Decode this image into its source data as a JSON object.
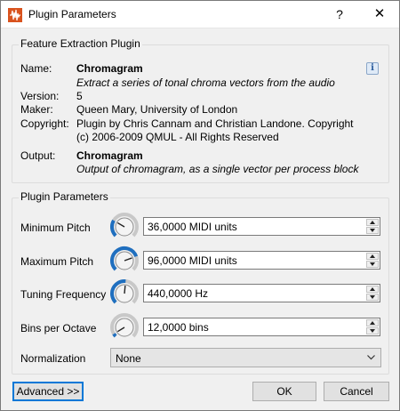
{
  "window": {
    "title": "Plugin Parameters",
    "help": "?",
    "close": "✕"
  },
  "feature_group": {
    "title": "Feature Extraction Plugin",
    "name_label": "Name:",
    "name_value": "Chromagram",
    "name_desc": "Extract a series of tonal chroma vectors from the audio",
    "version_label": "Version:",
    "version_value": "5",
    "maker_label": "Maker:",
    "maker_value": "Queen Mary, University of London",
    "copyright_label": "Copyright:",
    "copyright_line1": "Plugin by Chris Cannam and Christian Landone.  Copyright",
    "copyright_line2": "(c) 2006-2009 QMUL - All Rights Reserved",
    "output_label": "Output:",
    "output_value": "Chromagram",
    "output_desc": "Output of chromagram, as a single vector per process block",
    "info_icon": "i"
  },
  "params_group": {
    "title": "Plugin Parameters",
    "params": [
      {
        "label": "Minimum Pitch",
        "value": "36,0000 MIDI units",
        "level": 0.28
      },
      {
        "label": "Maximum Pitch",
        "value": "96,0000 MIDI units",
        "level": 0.76
      },
      {
        "label": "Tuning Frequency",
        "value": "440,0000 Hz",
        "level": 0.52
      },
      {
        "label": "Bins per Octave",
        "value": "12,0000 bins",
        "level": 0.05
      }
    ],
    "normalization_label": "Normalization",
    "normalization_value": "None"
  },
  "buttons": {
    "advanced": "Advanced >>",
    "ok": "OK",
    "cancel": "Cancel"
  },
  "colors": {
    "knob_arc": "#1f6fbf",
    "accent": "#0078d7"
  }
}
